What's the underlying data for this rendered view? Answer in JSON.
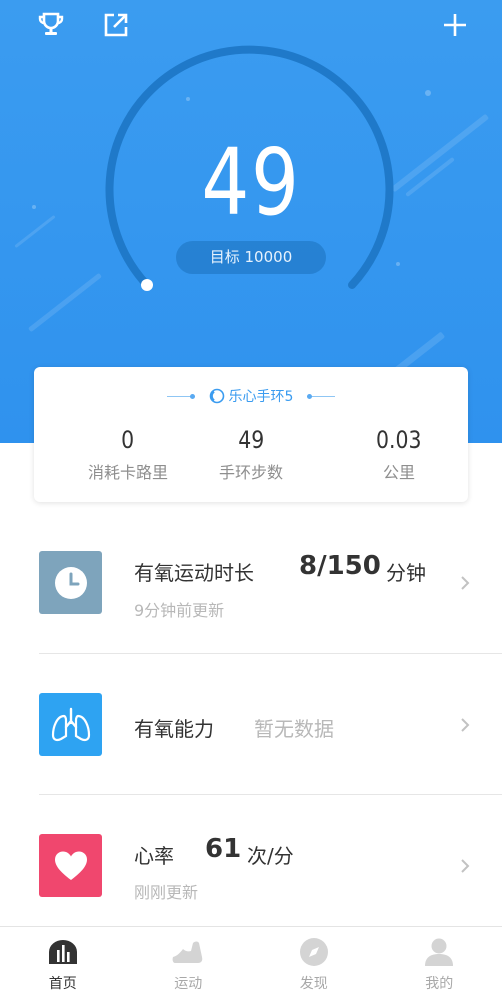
{
  "header": {
    "steps": "49",
    "goal_label": "目标 10000",
    "icons": [
      "trophy-icon",
      "share-icon",
      "plus-icon"
    ]
  },
  "summary": {
    "device_name": "乐心手环5",
    "stats": [
      {
        "value": "0",
        "label": "消耗卡路里"
      },
      {
        "value": "49",
        "label": "手环步数"
      },
      {
        "value": "0.03",
        "label": "公里"
      }
    ]
  },
  "metrics": {
    "aerobic_duration": {
      "title": "有氧运动时长",
      "value": "8/150",
      "unit": "分钟",
      "updated": "9分钟前更新"
    },
    "aerobic_capacity": {
      "title": "有氧能力",
      "status": "暂无数据"
    },
    "heart_rate": {
      "title": "心率",
      "value": "61",
      "unit": "次/分",
      "updated": "刚刚更新"
    }
  },
  "nav": [
    {
      "label": "首页",
      "icon": "home-chart-icon",
      "active": true
    },
    {
      "label": "运动",
      "icon": "shoe-icon",
      "active": false
    },
    {
      "label": "发现",
      "icon": "compass-icon",
      "active": false
    },
    {
      "label": "我的",
      "icon": "profile-icon",
      "active": false
    }
  ],
  "colors": {
    "hero_blue": "#3b9cf0",
    "clock_tile": "#7ea4bc",
    "lungs_tile": "#2ea3f2",
    "heart_tile": "#f0476e"
  }
}
